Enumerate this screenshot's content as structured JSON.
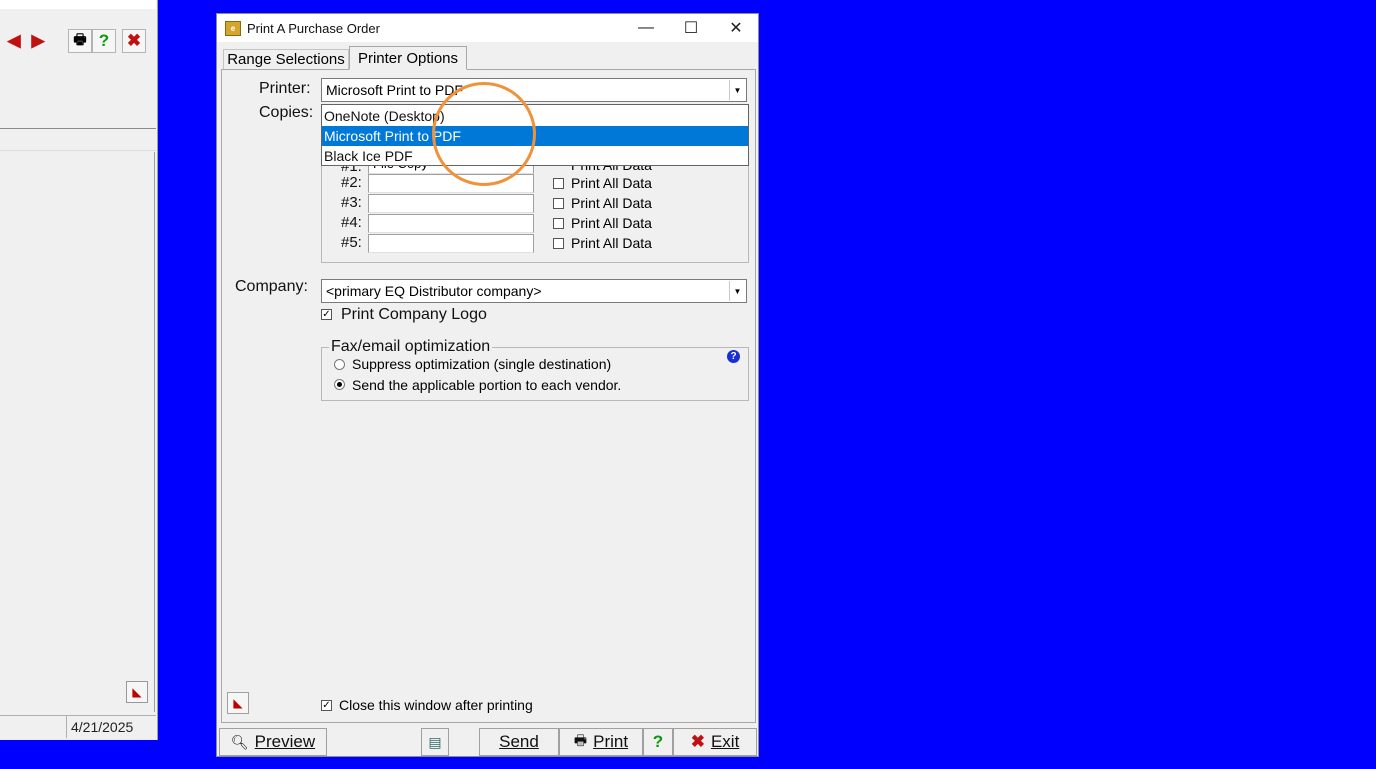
{
  "background_window": {
    "status_date": "4/21/2025",
    "toolbar_icons": [
      "back-arrow-icon",
      "forward-arrow-icon",
      "printer-icon",
      "help-icon",
      "close-x-icon"
    ]
  },
  "dialog": {
    "title": "Print A Purchase Order",
    "window_buttons": {
      "minimize": "—",
      "maximize": "☐",
      "close": "✕"
    },
    "tabs": [
      {
        "label": "Range Selections",
        "active": false
      },
      {
        "label": "Printer Options",
        "active": true
      }
    ],
    "printer": {
      "label": "Printer:",
      "value": "Microsoft Print to PDF",
      "options": [
        "OneNote (Desktop)",
        "Microsoft Print to PDF",
        "Black Ice PDF"
      ],
      "selected_index": 1
    },
    "copies": {
      "label": "Copies:",
      "first_row_partial_label": "#1:",
      "first_row_partial_value": "File Copy",
      "rows": [
        {
          "label": "#2:",
          "value": "",
          "print_all_label": "Print All Data",
          "checked": false
        },
        {
          "label": "#3:",
          "value": "",
          "print_all_label": "Print All Data",
          "checked": false
        },
        {
          "label": "#4:",
          "value": "",
          "print_all_label": "Print All Data",
          "checked": false
        },
        {
          "label": "#5:",
          "value": "",
          "print_all_label": "Print All Data",
          "checked": false
        }
      ],
      "first_row_print_all_label": "Print All Data"
    },
    "company": {
      "label": "Company:",
      "value": "<primary EQ Distributor company>",
      "print_logo_label": "Print Company Logo",
      "print_logo_checked": true
    },
    "fax_email": {
      "legend": "Fax/email optimization",
      "options": [
        {
          "label": "Suppress optimization (single destination)",
          "selected": false
        },
        {
          "label": "Send the applicable portion to each vendor.",
          "selected": true
        }
      ]
    },
    "close_after_printing": {
      "label": "Close this window after printing",
      "checked": true
    },
    "buttons": {
      "preview": "Preview",
      "send": "Send",
      "print": "Print",
      "help": "?",
      "exit": "Exit"
    },
    "colors": {
      "selection": "#0078d7",
      "desktop": "#0000ff",
      "highlight_ring": "#f0923a"
    }
  }
}
